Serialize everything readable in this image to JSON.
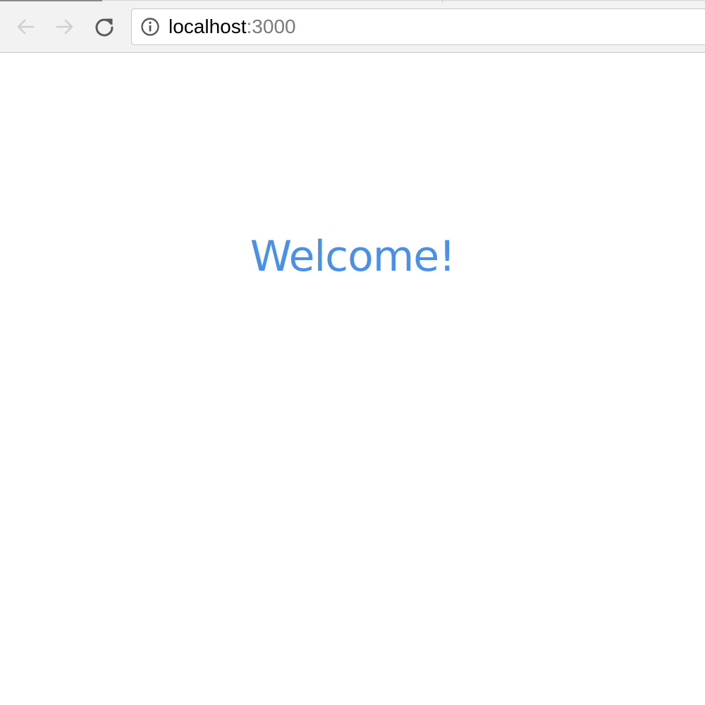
{
  "browser": {
    "url_host": "localhost",
    "url_separator": ":",
    "url_port": "3000",
    "icons": {
      "back": "arrow-left-icon",
      "forward": "arrow-right-icon",
      "reload": "reload-icon",
      "info": "info-icon"
    },
    "colors": {
      "nav_disabled": "#cfcfcf",
      "nav_enabled": "#5a5a5a",
      "port": "#7a7a7a"
    }
  },
  "page": {
    "heading": "Welcome!",
    "heading_color": "#4a90e9"
  }
}
